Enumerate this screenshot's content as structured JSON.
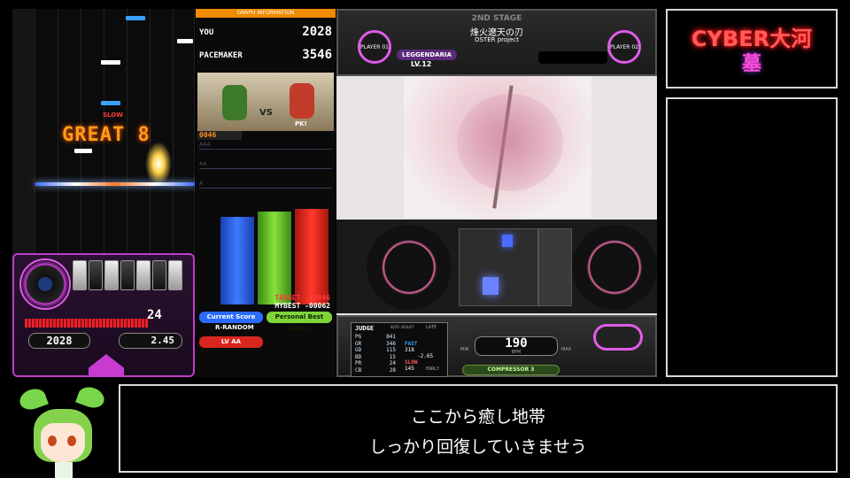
{
  "lane_area": {
    "judgement": "GREAT 8",
    "timing": "SLOW"
  },
  "deck": {
    "combo": "24",
    "score": "2028",
    "hi_speed": "2.45"
  },
  "graph": {
    "header": "GRAPH INFORMATION",
    "you_label": "YOU",
    "you_score": "2028",
    "pacemaker_label": "PACEMAKER",
    "pacemaker_score": "3546",
    "vs_label": "VS",
    "rival_name": "PK!",
    "mini_score": "0046",
    "grade_labels": [
      "AAA",
      "AA",
      "A"
    ],
    "target_text": "TARGET -00046",
    "mybest_text": "MYBEST -00062",
    "current_score_tag": "Current Score",
    "personal_best_tag": "Personal Best Score",
    "random_option": "R-RANDOM",
    "target_grade": "LV AA",
    "bars": [
      {
        "name": "current",
        "value": 0.66,
        "color": "#2a5ff0"
      },
      {
        "name": "pacemaker",
        "value": 0.7,
        "color": "#6fd12a"
      },
      {
        "name": "best",
        "value": 0.72,
        "color": "#e8231f"
      }
    ]
  },
  "stage": {
    "stage_label": "2ND STAGE",
    "song_title": "烽火遼天の刃",
    "artist": "OSTER project",
    "player1_label": "PLAYER 01",
    "player2_label": "PLAYER 02",
    "difficulty": "LEGGENDARIA",
    "level": "LV.12"
  },
  "judge_panel": {
    "title": "JUDGE",
    "auto_adjust": "AUTO ADJUST",
    "late": "LATE",
    "rows": [
      {
        "label": "PG",
        "value": "841"
      },
      {
        "label": "GR",
        "value": "346"
      },
      {
        "label": "GD",
        "value": "115"
      },
      {
        "label": "BD",
        "value": "15"
      },
      {
        "label": "PR",
        "value": "24"
      },
      {
        "label": "CB",
        "value": "28"
      }
    ],
    "fast_label": "FAST",
    "fast_value": "318",
    "slow_label": "SLOW",
    "slow_value": "145",
    "offset": "-2.65",
    "early": "EARLY",
    "bpm_value": "190",
    "bpm_label": "BPM",
    "min_label": "MIN",
    "max_label": "MAX",
    "effect": "COMPRESSOR 3"
  },
  "streamer": {
    "name_line1": "CYBER大河",
    "name_line2": "墓"
  },
  "subtitle": {
    "line1": "ここから癒し地帯",
    "line2": "しっかり回復していきませう"
  }
}
